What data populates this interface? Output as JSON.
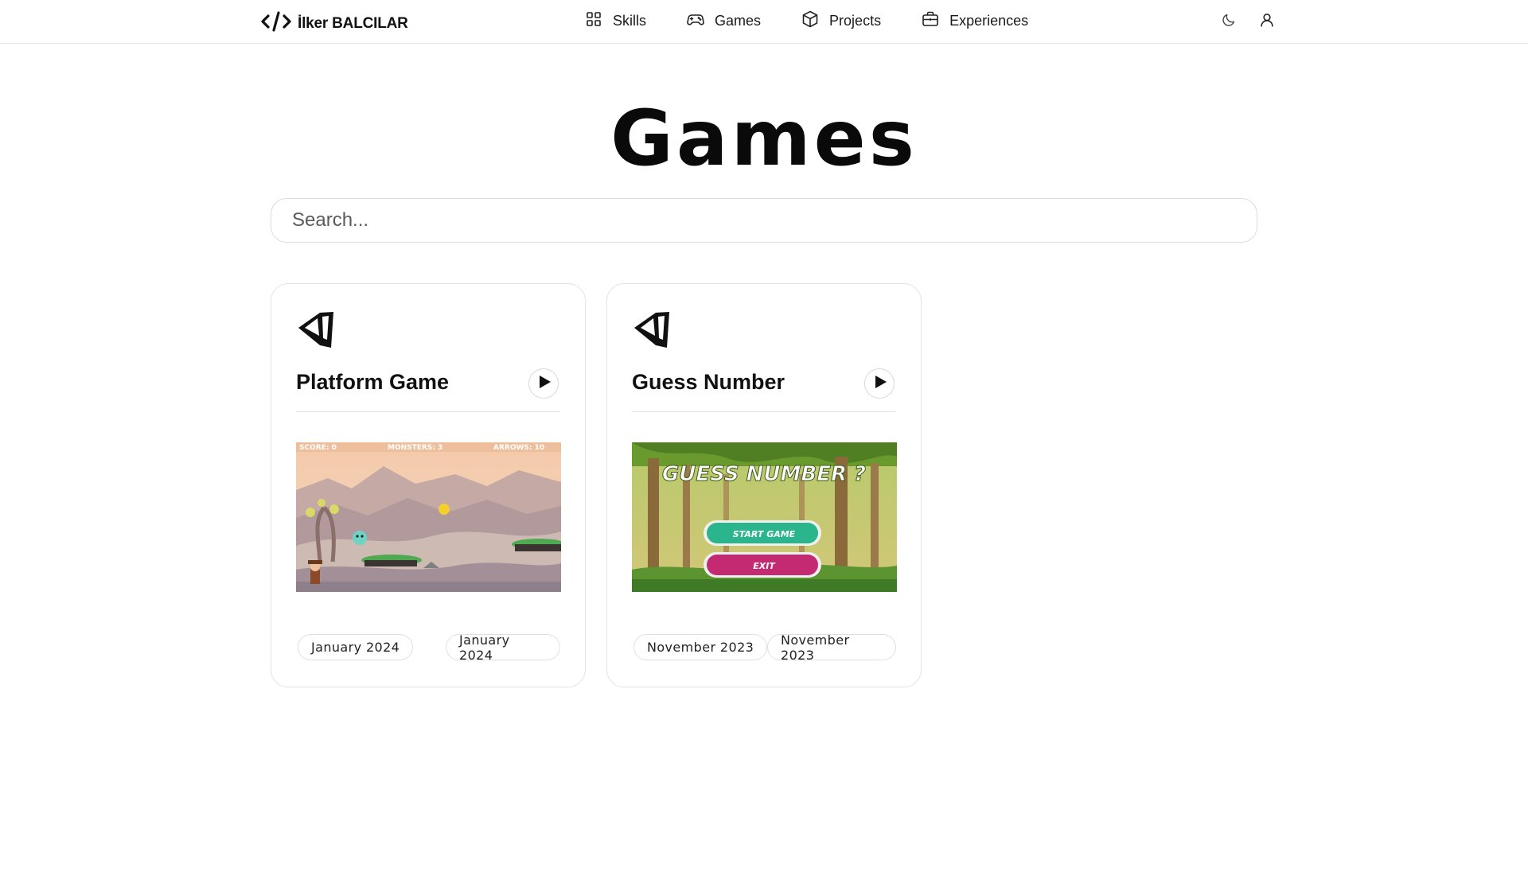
{
  "brand": {
    "name": "İlker BALCILAR",
    "icon": "code-brackets-icon"
  },
  "nav": [
    {
      "id": "skills",
      "label": "Skills",
      "icon": "grid-icon"
    },
    {
      "id": "games",
      "label": "Games",
      "icon": "gamepad-icon"
    },
    {
      "id": "projects",
      "label": "Projects",
      "icon": "box-icon"
    },
    {
      "id": "experiences",
      "label": "Experiences",
      "icon": "briefcase-icon"
    }
  ],
  "header_actions": {
    "theme_icon": "moon-icon",
    "user_icon": "user-icon"
  },
  "page": {
    "title": "Games"
  },
  "search": {
    "placeholder": "Search...",
    "value": ""
  },
  "games": [
    {
      "title": "Platform Game",
      "engine_icon": "unity-icon",
      "tags": [
        "January 2024",
        "January 2024"
      ],
      "thumbnail_text": {
        "score": "SCORE: 0",
        "monsters": "MONSTERS: 3",
        "arrows": "ARROWS: 10"
      }
    },
    {
      "title": "Guess Number",
      "engine_icon": "unity-icon",
      "tags": [
        "November 2023",
        "November 2023"
      ],
      "thumbnail_text": {
        "heading": "GUESS NUMBER ?",
        "start": "START GAME",
        "exit": "EXIT"
      }
    }
  ],
  "colors": {
    "text": "#111111",
    "border": "#e3e3e3",
    "background": "#ffffff"
  }
}
